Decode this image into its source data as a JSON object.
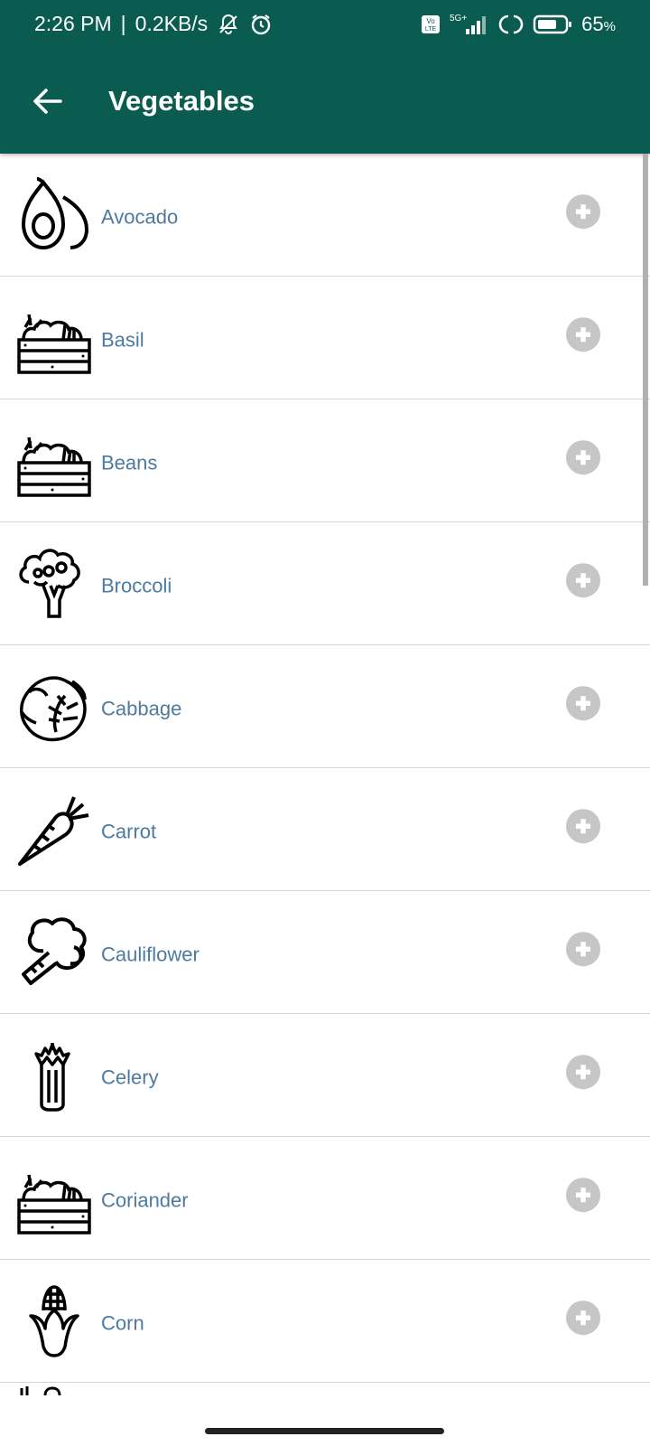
{
  "status_bar": {
    "time": "2:26 PM",
    "speed": "0.2KB/s",
    "network": "5G+",
    "volte": "Vo LTE",
    "battery": "65",
    "battery_unit": "%",
    "icons": [
      "mute-icon",
      "alarm-icon",
      "volte-icon",
      "signal-icon",
      "sync-icon",
      "battery-icon"
    ]
  },
  "app_bar": {
    "title": "Vegetables",
    "back_icon": "arrow-left-icon"
  },
  "colors": {
    "primary": "#0a5c51",
    "label": "#4c7aa0",
    "add_button": "#c6c6c6"
  },
  "items": [
    {
      "label": "Avocado",
      "icon": "avocado-icon"
    },
    {
      "label": "Basil",
      "icon": "vegetable-crate-icon"
    },
    {
      "label": "Beans",
      "icon": "vegetable-crate-icon"
    },
    {
      "label": "Broccoli",
      "icon": "broccoli-icon"
    },
    {
      "label": "Cabbage",
      "icon": "cabbage-icon"
    },
    {
      "label": "Carrot",
      "icon": "carrot-icon"
    },
    {
      "label": "Cauliflower",
      "icon": "cauliflower-icon"
    },
    {
      "label": "Celery",
      "icon": "celery-icon"
    },
    {
      "label": "Coriander",
      "icon": "vegetable-crate-icon"
    },
    {
      "label": "Corn",
      "icon": "corn-icon"
    }
  ]
}
